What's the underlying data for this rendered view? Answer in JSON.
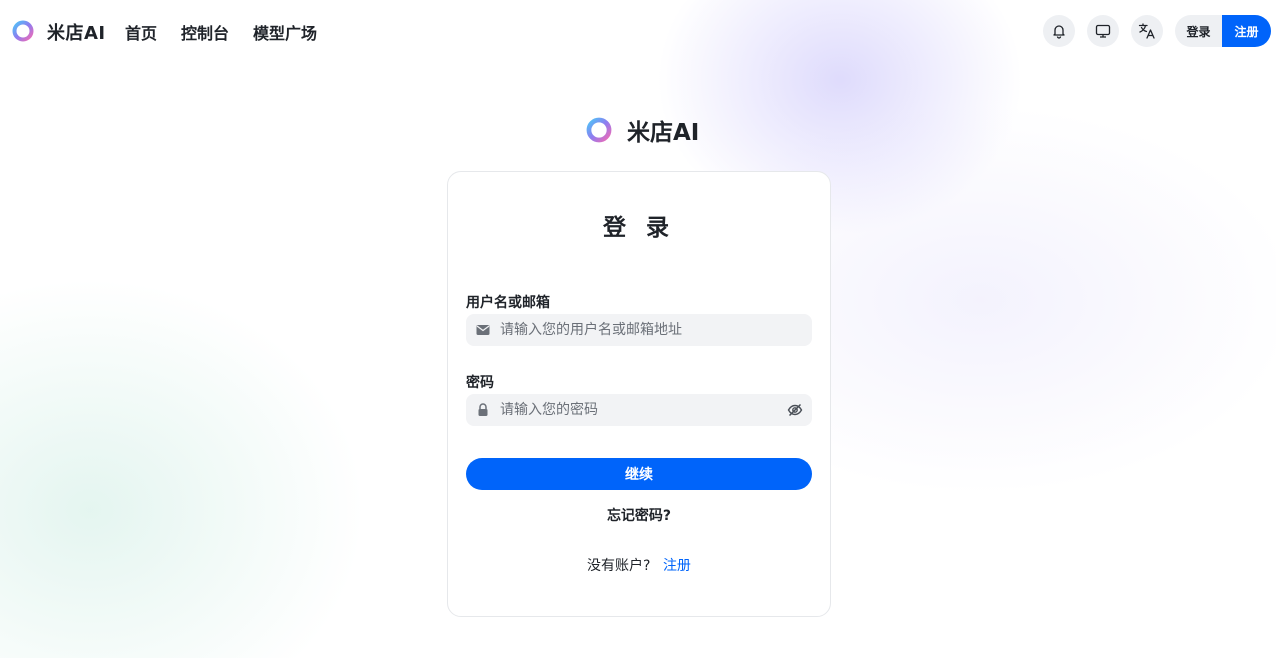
{
  "header": {
    "brand": "米店AI",
    "nav": [
      "首页",
      "控制台",
      "模型广场"
    ],
    "login_label": "登录",
    "register_label": "注册"
  },
  "center_brand": "米店AI",
  "form": {
    "title": "登 录",
    "username_label": "用户名或邮箱",
    "username_placeholder": "请输入您的用户名或邮箱地址",
    "password_label": "密码",
    "password_placeholder": "请输入您的密码",
    "submit_label": "继续",
    "forgot_label": "忘记密码?",
    "no_account_text": "没有账户?",
    "signup_label": "注册"
  },
  "icons": {
    "notifications": "bell-icon",
    "display": "monitor-icon",
    "language": "translate-icon",
    "username_field": "mail-icon",
    "password_field": "lock-icon",
    "password_toggle": "eye-off-icon"
  },
  "colors": {
    "accent": "#0064fa",
    "text": "#1f2329",
    "input_bg": "#f2f3f5"
  }
}
